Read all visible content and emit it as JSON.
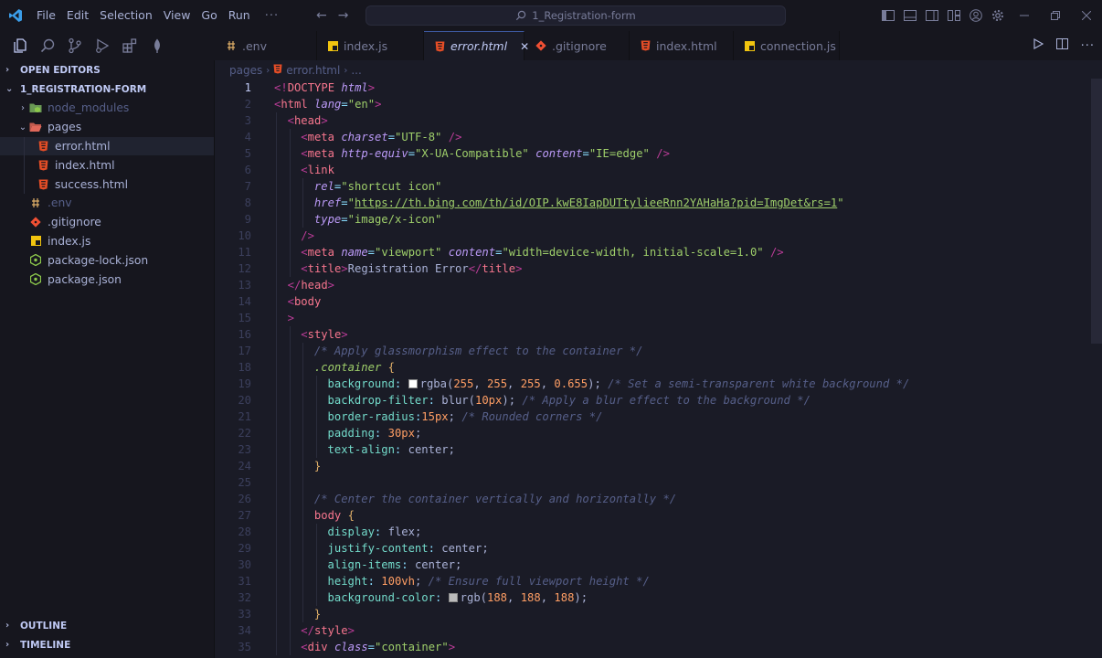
{
  "titlebar": {
    "menu": [
      "File",
      "Edit",
      "Selection",
      "View",
      "Go",
      "Run"
    ],
    "more": "···",
    "search": "1_Registration-form"
  },
  "activity_icons": [
    "files-icon",
    "search-icon",
    "source-control-icon",
    "run-debug-icon",
    "extensions-icon",
    "mongodb-leaf-icon"
  ],
  "sidebar": {
    "open_editors": "OPEN EDITORS",
    "project": "1_REGISTRATION-FORM",
    "items": [
      {
        "label": "node_modules",
        "icon": "folder-node-icon",
        "twisty": "›",
        "depth": 1,
        "dim": true
      },
      {
        "label": "pages",
        "icon": "folder-open-icon",
        "twisty": "⌄",
        "depth": 1
      },
      {
        "label": "error.html",
        "icon": "html-icon",
        "depth": 2,
        "selected": true
      },
      {
        "label": "index.html",
        "icon": "html-icon",
        "depth": 2
      },
      {
        "label": "success.html",
        "icon": "html-icon",
        "depth": 2
      },
      {
        "label": ".env",
        "icon": "env-icon",
        "depth": 1,
        "dim": true
      },
      {
        "label": ".gitignore",
        "icon": "git-icon",
        "depth": 1
      },
      {
        "label": "index.js",
        "icon": "js-icon",
        "depth": 1
      },
      {
        "label": "package-lock.json",
        "icon": "node-json-icon",
        "depth": 1
      },
      {
        "label": "package.json",
        "icon": "node-json-icon",
        "depth": 1
      }
    ],
    "outline": "OUTLINE",
    "timeline": "TIMELINE"
  },
  "tabs": [
    {
      "label": ".env",
      "icon": "env-icon"
    },
    {
      "label": "index.js",
      "icon": "js-icon"
    },
    {
      "label": "error.html",
      "icon": "html-icon",
      "active": true,
      "close": "✕"
    },
    {
      "label": ".gitignore",
      "icon": "git-icon"
    },
    {
      "label": "index.html",
      "icon": "html-icon"
    },
    {
      "label": "connection.js",
      "icon": "js-icon"
    }
  ],
  "breadcrumb": {
    "folder": "pages",
    "file": "error.html",
    "rest": "..."
  },
  "colors": {
    "html": "#e44d26",
    "js": "#f1c40f",
    "git": "#f05033",
    "node": "#8cc84b",
    "accent": "#3d59a1"
  },
  "editor": {
    "current_line": 1,
    "lines": [
      {
        "n": "1",
        "indent": 0,
        "tokens": [
          [
            "t-punct",
            "<!"
          ],
          [
            "t-tag",
            "DOCTYPE"
          ],
          [
            "t-text",
            " "
          ],
          [
            "t-attr",
            "html"
          ],
          [
            "t-punct",
            ">"
          ]
        ]
      },
      {
        "n": "2",
        "indent": 0,
        "tokens": [
          [
            "t-punct",
            "<"
          ],
          [
            "t-tag",
            "html"
          ],
          [
            "t-text",
            " "
          ],
          [
            "t-attr",
            "lang"
          ],
          [
            "t-eq",
            "="
          ],
          [
            "t-str",
            "\"en\""
          ],
          [
            "t-punct",
            ">"
          ]
        ]
      },
      {
        "n": "3",
        "indent": 1,
        "tokens": [
          [
            "t-punct",
            "<"
          ],
          [
            "t-tag",
            "head"
          ],
          [
            "t-punct",
            ">"
          ]
        ]
      },
      {
        "n": "4",
        "indent": 2,
        "tokens": [
          [
            "t-punct",
            "<"
          ],
          [
            "t-tag",
            "meta"
          ],
          [
            "t-text",
            " "
          ],
          [
            "t-attr",
            "charset"
          ],
          [
            "t-eq",
            "="
          ],
          [
            "t-str",
            "\"UTF-8\""
          ],
          [
            "t-text",
            " "
          ],
          [
            "t-punct",
            "/>"
          ]
        ]
      },
      {
        "n": "5",
        "indent": 2,
        "tokens": [
          [
            "t-punct",
            "<"
          ],
          [
            "t-tag",
            "meta"
          ],
          [
            "t-text",
            " "
          ],
          [
            "t-attr",
            "http-equiv"
          ],
          [
            "t-eq",
            "="
          ],
          [
            "t-str",
            "\"X-UA-Compatible\""
          ],
          [
            "t-text",
            " "
          ],
          [
            "t-attr",
            "content"
          ],
          [
            "t-eq",
            "="
          ],
          [
            "t-str",
            "\"IE=edge\""
          ],
          [
            "t-text",
            " "
          ],
          [
            "t-punct",
            "/>"
          ]
        ]
      },
      {
        "n": "6",
        "indent": 2,
        "tokens": [
          [
            "t-punct",
            "<"
          ],
          [
            "t-tag",
            "link"
          ]
        ]
      },
      {
        "n": "7",
        "indent": 3,
        "tokens": [
          [
            "t-attr",
            "rel"
          ],
          [
            "t-eq",
            "="
          ],
          [
            "t-str",
            "\"shortcut icon\""
          ]
        ]
      },
      {
        "n": "8",
        "indent": 3,
        "tokens": [
          [
            "t-attr",
            "href"
          ],
          [
            "t-eq",
            "="
          ],
          [
            "t-str",
            "\""
          ],
          [
            "t-link",
            "https://th.bing.com/th/id/OIP.kwE8IapDUTtylieeRnn2YAHaHa?pid=ImgDet&rs=1"
          ],
          [
            "t-str",
            "\""
          ]
        ]
      },
      {
        "n": "9",
        "indent": 3,
        "tokens": [
          [
            "t-attr",
            "type"
          ],
          [
            "t-eq",
            "="
          ],
          [
            "t-str",
            "\"image/x-icon\""
          ]
        ]
      },
      {
        "n": "10",
        "indent": 2,
        "tokens": [
          [
            "t-punct",
            "/>"
          ]
        ]
      },
      {
        "n": "11",
        "indent": 2,
        "tokens": [
          [
            "t-punct",
            "<"
          ],
          [
            "t-tag",
            "meta"
          ],
          [
            "t-text",
            " "
          ],
          [
            "t-attr",
            "name"
          ],
          [
            "t-eq",
            "="
          ],
          [
            "t-str",
            "\"viewport\""
          ],
          [
            "t-text",
            " "
          ],
          [
            "t-attr",
            "content"
          ],
          [
            "t-eq",
            "="
          ],
          [
            "t-str",
            "\"width=device-width, initial-scale=1.0\""
          ],
          [
            "t-text",
            " "
          ],
          [
            "t-punct",
            "/>"
          ]
        ]
      },
      {
        "n": "12",
        "indent": 2,
        "tokens": [
          [
            "t-punct",
            "<"
          ],
          [
            "t-tag",
            "title"
          ],
          [
            "t-punct",
            ">"
          ],
          [
            "t-text",
            "Registration Error"
          ],
          [
            "t-punct",
            "</"
          ],
          [
            "t-tag",
            "title"
          ],
          [
            "t-punct",
            ">"
          ]
        ]
      },
      {
        "n": "13",
        "indent": 1,
        "tokens": [
          [
            "t-punct",
            "</"
          ],
          [
            "t-tag",
            "head"
          ],
          [
            "t-punct",
            ">"
          ]
        ]
      },
      {
        "n": "14",
        "indent": 1,
        "tokens": [
          [
            "t-punct",
            "<"
          ],
          [
            "t-tag",
            "body"
          ]
        ]
      },
      {
        "n": "15",
        "indent": 1,
        "tokens": [
          [
            "t-punct",
            ">"
          ]
        ]
      },
      {
        "n": "16",
        "indent": 2,
        "tokens": [
          [
            "t-punct",
            "<"
          ],
          [
            "t-tag",
            "style"
          ],
          [
            "t-punct",
            ">"
          ]
        ]
      },
      {
        "n": "17",
        "indent": 3,
        "tokens": [
          [
            "t-comment",
            "/* Apply glassmorphism effect to the container */"
          ]
        ]
      },
      {
        "n": "18",
        "indent": 3,
        "tokens": [
          [
            "t-sel",
            ".container"
          ],
          [
            "t-text",
            " "
          ],
          [
            "t-brace",
            "{"
          ]
        ]
      },
      {
        "n": "19",
        "indent": 4,
        "tokens": [
          [
            "t-prop",
            "background"
          ],
          [
            "t-eq",
            ": "
          ],
          [
            "swatch",
            "#ffffff"
          ],
          [
            "t-kw",
            "rgba"
          ],
          [
            "t-text",
            "("
          ],
          [
            "t-val",
            "255"
          ],
          [
            "t-text",
            ", "
          ],
          [
            "t-val",
            "255"
          ],
          [
            "t-text",
            ", "
          ],
          [
            "t-val",
            "255"
          ],
          [
            "t-text",
            ", "
          ],
          [
            "t-val",
            "0.655"
          ],
          [
            "t-text",
            ");"
          ],
          [
            "t-text",
            " "
          ],
          [
            "t-comment",
            "/* Set a semi-transparent white background */"
          ]
        ]
      },
      {
        "n": "20",
        "indent": 4,
        "tokens": [
          [
            "t-prop",
            "backdrop-filter"
          ],
          [
            "t-eq",
            ": "
          ],
          [
            "t-kw",
            "blur"
          ],
          [
            "t-text",
            "("
          ],
          [
            "t-val",
            "10px"
          ],
          [
            "t-text",
            ");"
          ],
          [
            "t-text",
            " "
          ],
          [
            "t-comment",
            "/* Apply a blur effect to the background */"
          ]
        ]
      },
      {
        "n": "21",
        "indent": 4,
        "tokens": [
          [
            "t-prop",
            "border-radius"
          ],
          [
            "t-eq",
            ":"
          ],
          [
            "t-val",
            "15px"
          ],
          [
            "t-text",
            ";"
          ],
          [
            "t-text",
            " "
          ],
          [
            "t-comment",
            "/* Rounded corners */"
          ]
        ]
      },
      {
        "n": "22",
        "indent": 4,
        "tokens": [
          [
            "t-prop",
            "padding"
          ],
          [
            "t-eq",
            ": "
          ],
          [
            "t-val",
            "30px"
          ],
          [
            "t-text",
            ";"
          ]
        ]
      },
      {
        "n": "23",
        "indent": 4,
        "tokens": [
          [
            "t-prop",
            "text-align"
          ],
          [
            "t-eq",
            ": "
          ],
          [
            "t-text",
            "center;"
          ]
        ]
      },
      {
        "n": "24",
        "indent": 3,
        "tokens": [
          [
            "t-brace",
            "}"
          ]
        ]
      },
      {
        "n": "25",
        "indent": 3,
        "tokens": []
      },
      {
        "n": "26",
        "indent": 3,
        "tokens": [
          [
            "t-comment",
            "/* Center the container vertically and horizontally */"
          ]
        ]
      },
      {
        "n": "27",
        "indent": 3,
        "tokens": [
          [
            "t-tag",
            "body"
          ],
          [
            "t-text",
            " "
          ],
          [
            "t-brace",
            "{"
          ]
        ]
      },
      {
        "n": "28",
        "indent": 4,
        "tokens": [
          [
            "t-prop",
            "display"
          ],
          [
            "t-eq",
            ": "
          ],
          [
            "t-text",
            "flex;"
          ]
        ]
      },
      {
        "n": "29",
        "indent": 4,
        "tokens": [
          [
            "t-prop",
            "justify-content"
          ],
          [
            "t-eq",
            ": "
          ],
          [
            "t-text",
            "center;"
          ]
        ]
      },
      {
        "n": "30",
        "indent": 4,
        "tokens": [
          [
            "t-prop",
            "align-items"
          ],
          [
            "t-eq",
            ": "
          ],
          [
            "t-text",
            "center;"
          ]
        ]
      },
      {
        "n": "31",
        "indent": 4,
        "tokens": [
          [
            "t-prop",
            "height"
          ],
          [
            "t-eq",
            ": "
          ],
          [
            "t-val",
            "100vh"
          ],
          [
            "t-text",
            ";"
          ],
          [
            "t-text",
            " "
          ],
          [
            "t-comment",
            "/* Ensure full viewport height */"
          ]
        ]
      },
      {
        "n": "32",
        "indent": 4,
        "tokens": [
          [
            "t-prop",
            "background-color"
          ],
          [
            "t-eq",
            ": "
          ],
          [
            "swatch",
            "#bcbcbc"
          ],
          [
            "t-kw",
            "rgb"
          ],
          [
            "t-text",
            "("
          ],
          [
            "t-val",
            "188"
          ],
          [
            "t-text",
            ", "
          ],
          [
            "t-val",
            "188"
          ],
          [
            "t-text",
            ", "
          ],
          [
            "t-val",
            "188"
          ],
          [
            "t-text",
            ");"
          ]
        ]
      },
      {
        "n": "33",
        "indent": 3,
        "tokens": [
          [
            "t-brace",
            "}"
          ]
        ]
      },
      {
        "n": "34",
        "indent": 2,
        "tokens": [
          [
            "t-punct",
            "</"
          ],
          [
            "t-tag",
            "style"
          ],
          [
            "t-punct",
            ">"
          ]
        ]
      },
      {
        "n": "35",
        "indent": 2,
        "tokens": [
          [
            "t-punct",
            "<"
          ],
          [
            "t-tag",
            "div"
          ],
          [
            "t-text",
            " "
          ],
          [
            "t-attr",
            "class"
          ],
          [
            "t-eq",
            "="
          ],
          [
            "t-str",
            "\"container\""
          ],
          [
            "t-punct",
            ">"
          ]
        ]
      }
    ]
  }
}
